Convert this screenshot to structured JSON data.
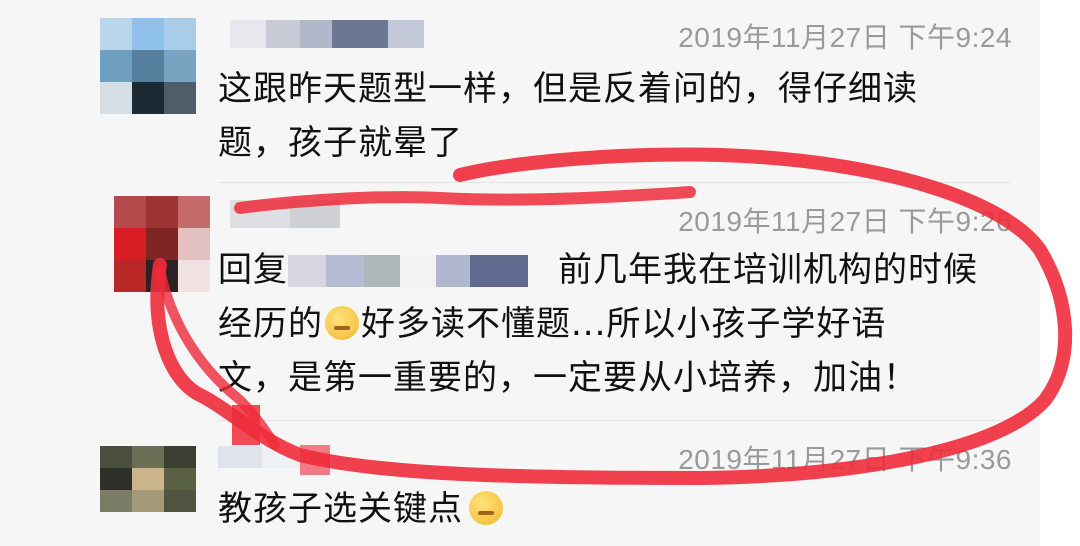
{
  "comments": [
    {
      "time": "2019年11月27日 下午9:24",
      "text_line1": "这跟昨天题型一样，但是反着问的，得仔细读",
      "text_line2": "题，孩子就晕了"
    },
    {
      "time": "2019年11月27日 下午9:26",
      "reply_prefix": "回复",
      "line1_tail": "前几年我在培训机构的时候",
      "line2_head": "经历的",
      "line2_tail": "好多读不懂题...所以小孩子学好语",
      "line3": "文，是第一重要的，一定要从小培养，加油！",
      "emoji_icon": "rolling-eyes-emoji-icon"
    },
    {
      "time": "2019年11月27日 下午9:36",
      "text": "教孩子选关键点",
      "emoji_icon": "thinking-emoji-icon"
    }
  ],
  "colors": {
    "annotation": "#ef2b3b",
    "timestamp": "#9a9a9a"
  }
}
